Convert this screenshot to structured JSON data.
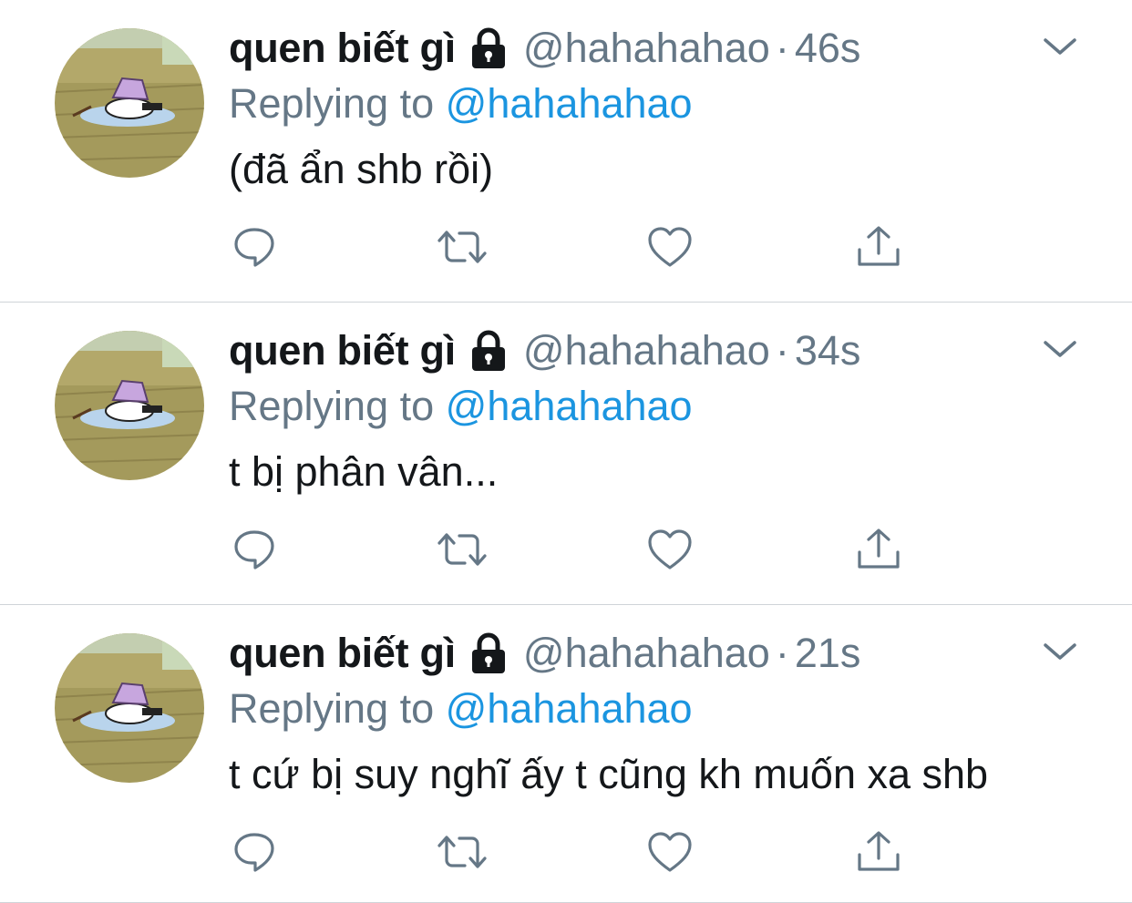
{
  "tweets": [
    {
      "name": "quen biết gì",
      "handle": "@hahahahao",
      "separator": "·",
      "time": "46s",
      "replying_prefix": "Replying to",
      "replying_mention": "@hahahahao",
      "text": "(đã ẩn shb rồi)"
    },
    {
      "name": "quen biết gì",
      "handle": "@hahahahao",
      "separator": "·",
      "time": "34s",
      "replying_prefix": "Replying to",
      "replying_mention": "@hahahahao",
      "text": "t bị phân vân..."
    },
    {
      "name": "quen biết gì",
      "handle": "@hahahahao",
      "separator": "·",
      "time": "21s",
      "replying_prefix": "Replying to",
      "replying_mention": "@hahahahao",
      "text": "t cứ bị suy nghĩ ấy t cũng kh muốn xa shb"
    }
  ],
  "icons": {
    "lock": "lock-icon",
    "menu": "chevron-down-icon",
    "reply": "reply-icon",
    "retweet": "retweet-icon",
    "like": "heart-icon",
    "share": "share-icon"
  },
  "colors": {
    "name": "#14171a",
    "secondary": "#657786",
    "link": "#1b95e0",
    "icon": "#657786",
    "divider": "#cfd4d8"
  }
}
